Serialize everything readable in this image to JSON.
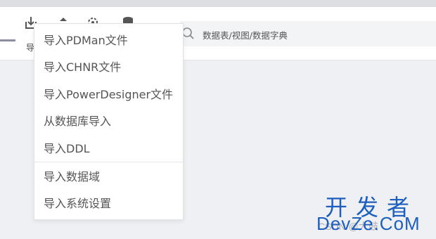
{
  "toolbar": {
    "import_label_visible": "导",
    "icons": [
      "import-icon",
      "export-icon",
      "settings-icon",
      "database-icon"
    ]
  },
  "search": {
    "placeholder": "数据表/视图/数据字典"
  },
  "import_menu": {
    "items": [
      {
        "label": "导入PDMan文件"
      },
      {
        "label": "导入CHNR文件"
      },
      {
        "label": "导入PowerDesigner文件"
      },
      {
        "label": "从数据库导入"
      },
      {
        "label": "导入DDL"
      },
      {
        "label": "导入数据域"
      },
      {
        "label": "导入系统设置"
      }
    ]
  },
  "watermark": {
    "title_cn": "开发者",
    "title_en": "DevZe.CoM",
    "faint_text": "CSDN @大鼓"
  },
  "colors": {
    "toolbar_bg": "#ffffff",
    "page_bg": "#eef0f3",
    "watermark": "#1d5fbf"
  }
}
